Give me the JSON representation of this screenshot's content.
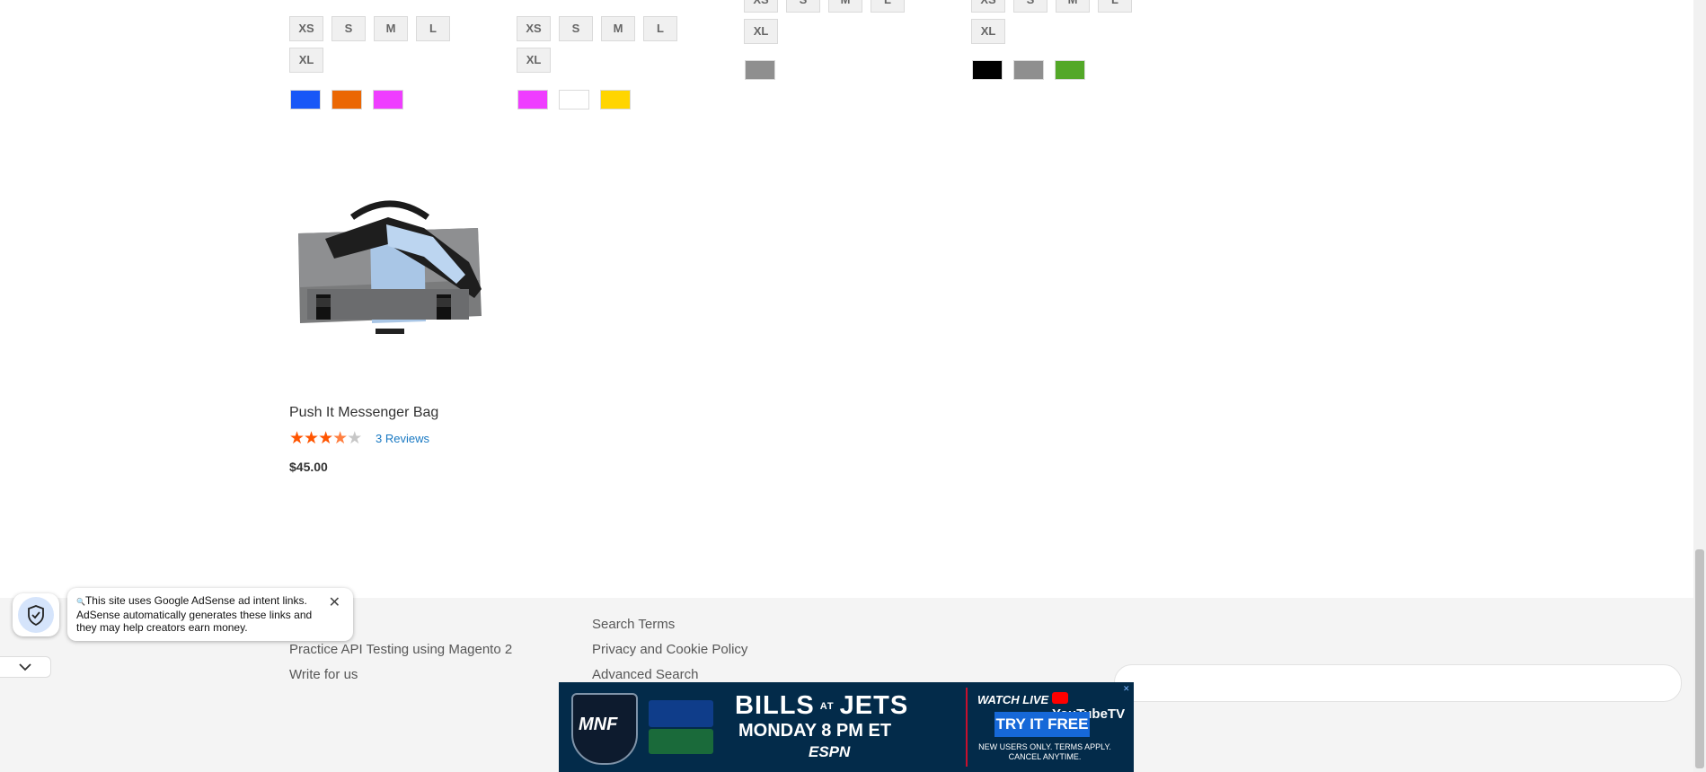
{
  "product_grid": {
    "card1": {
      "sizes_row1": [
        "XS",
        "S",
        "M",
        "L"
      ],
      "sizes_row2": [
        "XL"
      ],
      "colors": [
        "#1857f7",
        "#eb6703",
        "#ef3dff"
      ]
    },
    "card2": {
      "sizes_row1": [
        "XS",
        "S",
        "M",
        "L"
      ],
      "sizes_row2": [
        "XL"
      ],
      "colors": [
        "#ef3dff",
        "#ffffff",
        "#ffd500"
      ]
    },
    "card3": {
      "sizes_row1": [
        "XS",
        "S",
        "M",
        "L"
      ],
      "sizes_row2": [
        "XL"
      ],
      "colors": [
        "#8f8f8f"
      ]
    },
    "card4": {
      "sizes_row1": [
        "XS",
        "S",
        "M",
        "L"
      ],
      "sizes_row2": [
        "XL"
      ],
      "colors": [
        "#000000",
        "#8f8f8f",
        "#53a828"
      ]
    }
  },
  "featured_product": {
    "name": "Push It Messenger Bag",
    "rating_fraction": 0.6,
    "stars": "★★★★★",
    "reviews_label": "3 Reviews",
    "price": "$45.00",
    "image_icon": "messenger-bag-icon"
  },
  "footer": {
    "col1": [
      "Practice API Testing using Magento 2",
      "Write for us"
    ],
    "col2": [
      "Search Terms",
      "Privacy and Cookie Policy",
      "Advanced Search"
    ]
  },
  "adsense_notice": {
    "text": "This site uses Google AdSense ad intent links. AdSense automatically generates these links and they may help creators earn money.",
    "close_glyph": "✕",
    "search_glyph": "🔍"
  },
  "ad": {
    "title_left": "BILLS",
    "title_at": "AT",
    "title_right": "JETS",
    "date": "MONDAY 8 PM ET",
    "network": "ESPN",
    "badge": "MNF",
    "watch_live": "WATCH LIVE",
    "platform": "YouTubeTV",
    "cta": "TRY IT FREE",
    "fine_print": "NEW USERS ONLY. TERMS APPLY. CANCEL ANYTIME.",
    "close_glyph": "✕"
  },
  "colors": {
    "accent_link": "#1979c3",
    "star_filled": "#ff5501",
    "star_empty": "#c7c7c7",
    "footer_bg": "#f4f4f4"
  }
}
